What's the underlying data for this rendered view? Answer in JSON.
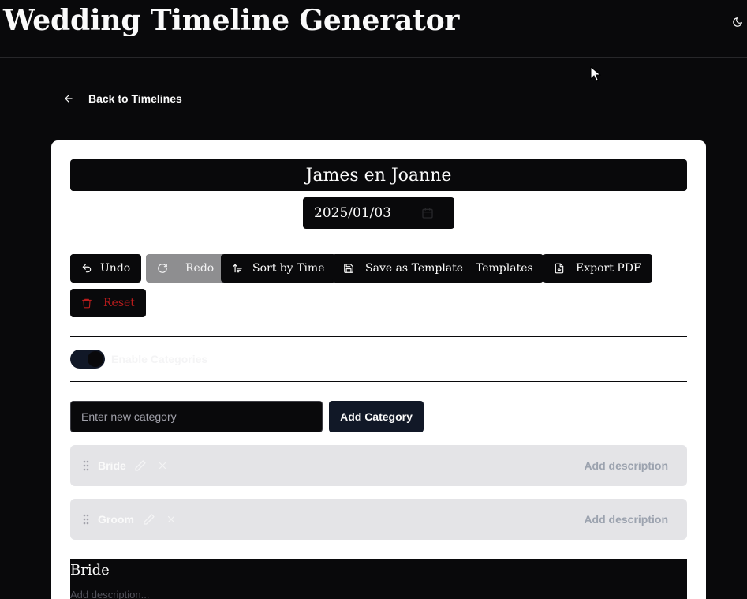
{
  "app": {
    "title": "Wedding Timeline Generator"
  },
  "nav": {
    "back_label": "Back to Timelines"
  },
  "timeline": {
    "title": "James en Joanne",
    "date": "2025/01/03"
  },
  "toolbar": {
    "undo": "Undo",
    "redo": "Redo",
    "sort": "Sort by Time",
    "save_template": "Save as Template",
    "templates": "Templates",
    "export_pdf": "Export PDF",
    "reset": "Reset"
  },
  "categories": {
    "toggle_label": "Enable Categories",
    "toggle_enabled": true,
    "new_placeholder": "Enter new category",
    "add_button": "Add Category",
    "items": [
      {
        "name": "Bride",
        "description_placeholder": "Add description"
      },
      {
        "name": "Groom",
        "description_placeholder": "Add description"
      }
    ]
  },
  "sections": [
    {
      "title": "Bride",
      "description_placeholder": "Add description..."
    }
  ],
  "colors": {
    "dark": "#09090b",
    "card": "#ffffff",
    "danger": "#b91c1c",
    "row": "#e4e4e7",
    "accent": "#111827"
  }
}
